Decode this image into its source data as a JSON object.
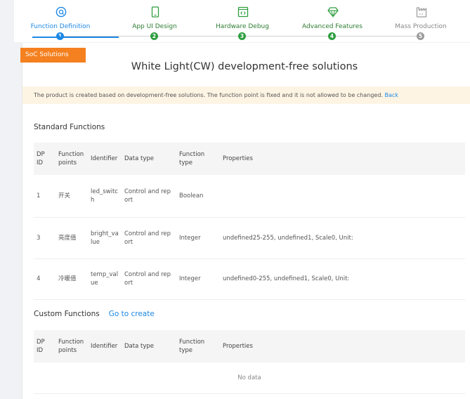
{
  "stepper": {
    "steps": [
      {
        "label": "Function Definition",
        "number": "1",
        "state": "active",
        "icon": "function-definition-icon"
      },
      {
        "label": "App UI Design",
        "number": "2",
        "state": "done",
        "icon": "phone-icon"
      },
      {
        "label": "Hardware Debug",
        "number": "3",
        "state": "done",
        "icon": "code-window-icon"
      },
      {
        "label": "Advanced Features",
        "number": "4",
        "state": "done",
        "icon": "diamond-icon"
      },
      {
        "label": "Mass Production",
        "number": "5",
        "state": "todo",
        "icon": "factory-icon"
      }
    ]
  },
  "tag": "SoC Solutions",
  "title": "White Light(CW) development-free solutions",
  "notice": {
    "text": "The product is created based on development-free solutions. The function point is fixed and it is not allowed to be changed.",
    "link": "Back"
  },
  "standard": {
    "title": "Standard Functions",
    "columns": [
      "DP ID",
      "Function points",
      "Identifier",
      "Data type",
      "Function type",
      "Properties"
    ],
    "rows": [
      {
        "id": "1",
        "point": "开关",
        "identifier": "led_switch",
        "data_type": "Control and report",
        "func_type": "Boolean",
        "properties": ""
      },
      {
        "id": "3",
        "point": "亮度值",
        "identifier": "bright_value",
        "data_type": "Control and report",
        "func_type": "Integer",
        "properties": "undefined25-255, undefined1, Scale0, Unit:"
      },
      {
        "id": "4",
        "point": "冷暖值",
        "identifier": "temp_value",
        "data_type": "Control and report",
        "func_type": "Integer",
        "properties": "undefined0-255, undefined1, Scale0, Unit:"
      }
    ]
  },
  "custom": {
    "title": "Custom Functions",
    "create_link": "Go to create",
    "columns": [
      "DP ID",
      "Function points",
      "Identifier",
      "Data type",
      "Function type",
      "Properties"
    ],
    "empty_text": "No data"
  },
  "colors": {
    "active": "#1e88e5",
    "done": "#2e9e3f",
    "todo": "#9a9a9a",
    "tag": "#f4801f",
    "notice_bg": "#fdf4e3"
  }
}
